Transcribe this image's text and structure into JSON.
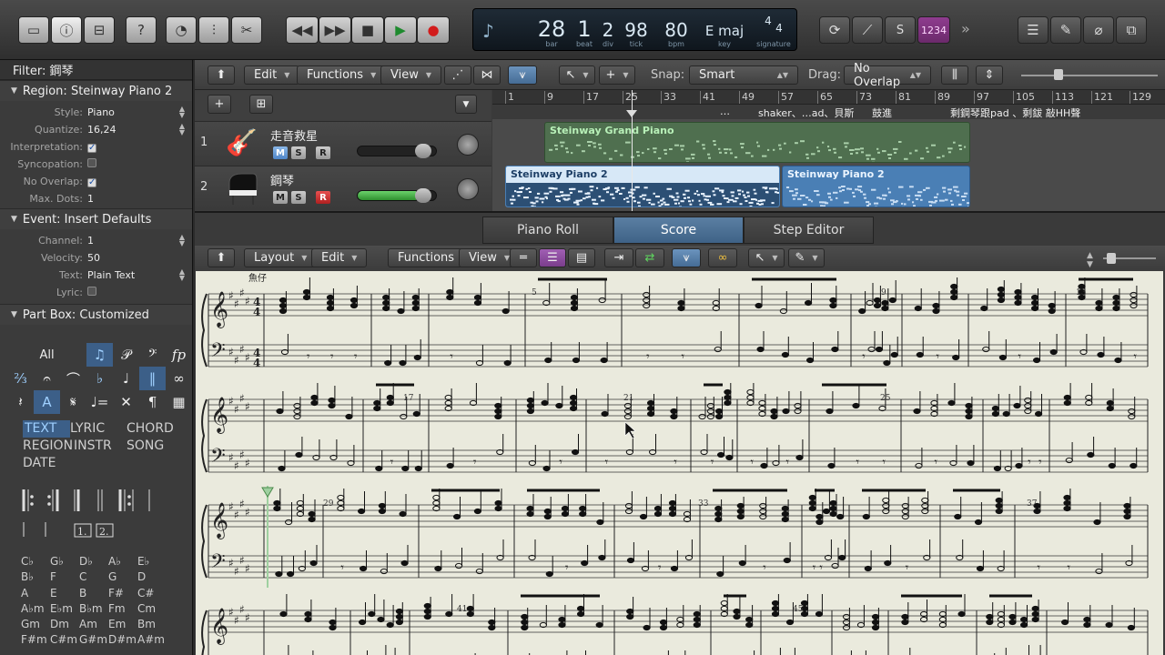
{
  "transport": {
    "bar": "28",
    "beat": "1",
    "div": "2",
    "tick": "98",
    "bpm": "80",
    "key": "E maj",
    "signature_top": "4",
    "signature_bottom": "4",
    "labels": {
      "bar": "bar",
      "beat": "beat",
      "div": "div",
      "tick": "tick",
      "bpm": "bpm",
      "key": "key",
      "signature": "signature"
    },
    "cpu_label": "1234"
  },
  "inspector": {
    "filter": "Filter: 鋼琴",
    "region_header": "Region:  Steinway Piano 2",
    "region_rows": [
      {
        "k": "Style:",
        "v": "Piano"
      },
      {
        "k": "Quantize:",
        "v": "16,24"
      },
      {
        "k": "Interpretation:",
        "v": "checked"
      },
      {
        "k": "Syncopation:",
        "v": "unchecked"
      },
      {
        "k": "No Overlap:",
        "v": "checked"
      },
      {
        "k": "Max. Dots:",
        "v": "1"
      }
    ],
    "event_header": "Event:  Insert Defaults",
    "event_rows": [
      {
        "k": "Channel:",
        "v": "1"
      },
      {
        "k": "Velocity:",
        "v": "50"
      },
      {
        "k": "Text:",
        "v": "Plain Text"
      },
      {
        "k": "Lyric:",
        "v": "unchecked"
      }
    ],
    "partbox_header": "Part Box:  Customized",
    "partbox_all": "All",
    "text_tokens": [
      "TEXT",
      "LYRIC",
      "CHORD",
      "REGION",
      "INSTR",
      "SONG",
      "DATE"
    ],
    "chords": [
      "C♭",
      "G♭",
      "D♭",
      "A♭",
      "E♭",
      "B♭",
      "F",
      "C",
      "G",
      "D",
      "A",
      "E",
      "B",
      "F#",
      "C#",
      "A♭m",
      "E♭m",
      "B♭m",
      "Fm",
      "Cm",
      "Gm",
      "Dm",
      "Am",
      "Em",
      "Bm",
      "F#m",
      "C#m",
      "G#m",
      "D#m",
      "A#m"
    ]
  },
  "tracks_toolbar": {
    "edit": "Edit",
    "functions": "Functions",
    "view": "View",
    "snap_label": "Snap:",
    "snap_value": "Smart",
    "drag_label": "Drag:",
    "drag_value": "No Overlap"
  },
  "ruler": [
    "1",
    "9",
    "17",
    "25",
    "33",
    "41",
    "49",
    "57",
    "65",
    "73",
    "81",
    "89",
    "97",
    "105",
    "113",
    "121",
    "129"
  ],
  "markers": [
    "…",
    "shaker、…ad、貝斯",
    "鼓進",
    "剩鋼琴跟pad 、剩鈸 敲HH聲"
  ],
  "tracks": [
    {
      "num": "1",
      "name": "走音救星",
      "m": "M",
      "s": "S",
      "r": "R"
    },
    {
      "num": "2",
      "name": "鋼琴",
      "m": "M",
      "s": "S",
      "r": "R"
    }
  ],
  "regions": [
    {
      "name": "Steinway Grand Piano"
    },
    {
      "name": "Steinway Piano 2"
    },
    {
      "name": "Steinway Piano 2"
    }
  ],
  "editor_tabs": [
    "Piano Roll",
    "Score",
    "Step Editor"
  ],
  "score_toolbar": {
    "layout": "Layout",
    "edit": "Edit",
    "functions": "Functions",
    "view": "View"
  },
  "score": {
    "text_above": "魚仔",
    "measure_numbers": [
      "5",
      "9",
      "13",
      "17",
      "21",
      "25",
      "29",
      "33",
      "37",
      "41",
      "45"
    ]
  },
  "colors": {
    "accent": "#5b7fa3",
    "region_green": "#4f6f4f",
    "region_blue": "#7fb4e0",
    "playhead": "#9fd0a0"
  }
}
